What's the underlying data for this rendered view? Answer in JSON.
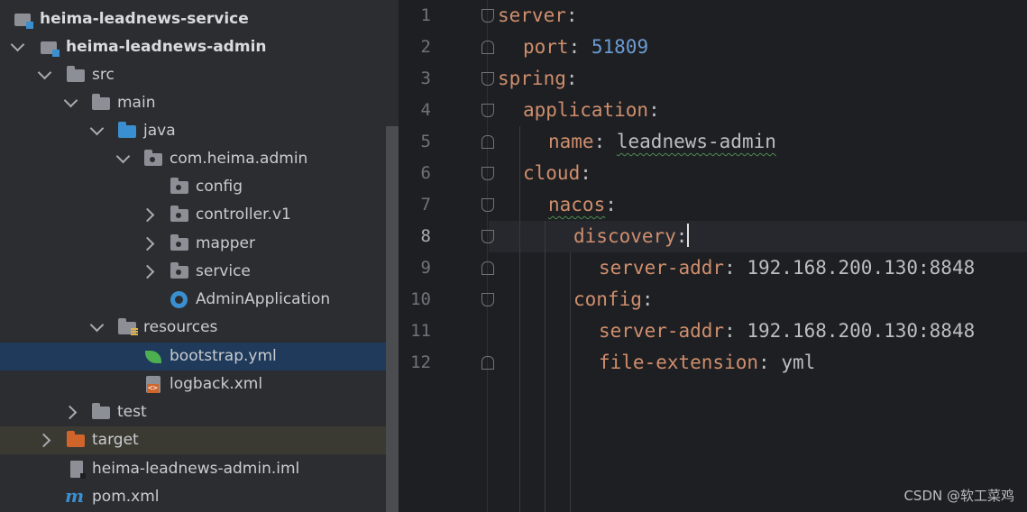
{
  "project_tree": {
    "items": [
      {
        "label": "heima-leadnews-service",
        "icon": "module-icon"
      },
      {
        "label": "heima-leadnews-admin",
        "icon": "module-icon"
      },
      {
        "label": "src",
        "icon": "folder-icon"
      },
      {
        "label": "main",
        "icon": "folder-icon"
      },
      {
        "label": "java",
        "icon": "source-folder-icon"
      },
      {
        "label": "com.heima.admin",
        "icon": "package-icon"
      },
      {
        "label": "config",
        "icon": "package-icon"
      },
      {
        "label": "controller.v1",
        "icon": "package-icon"
      },
      {
        "label": "mapper",
        "icon": "package-icon"
      },
      {
        "label": "service",
        "icon": "package-icon"
      },
      {
        "label": "AdminApplication",
        "icon": "spring-boot-app-icon"
      },
      {
        "label": "resources",
        "icon": "resources-folder-icon"
      },
      {
        "label": "bootstrap.yml",
        "icon": "spring-yaml-icon",
        "selected": true
      },
      {
        "label": "logback.xml",
        "icon": "xml-file-icon"
      },
      {
        "label": "test",
        "icon": "folder-icon"
      },
      {
        "label": "target",
        "icon": "excluded-folder-icon"
      },
      {
        "label": "heima-leadnews-admin.iml",
        "icon": "iml-file-icon"
      },
      {
        "label": "pom.xml",
        "icon": "maven-icon"
      }
    ]
  },
  "editor": {
    "line_numbers": [
      "1",
      "2",
      "3",
      "4",
      "5",
      "6",
      "7",
      "8",
      "9",
      "10",
      "11",
      "12"
    ],
    "current_line": "8",
    "lines": [
      {
        "key": "server",
        "sep": ":",
        "value": ""
      },
      {
        "key": "port",
        "sep": ": ",
        "value": "51809"
      },
      {
        "key": "spring",
        "sep": ":",
        "value": ""
      },
      {
        "key": "application",
        "sep": ":",
        "value": ""
      },
      {
        "key": "name",
        "sep": ": ",
        "value": "leadnews-admin"
      },
      {
        "key": "cloud",
        "sep": ":",
        "value": ""
      },
      {
        "key": "nacos",
        "sep": ":",
        "value": ""
      },
      {
        "key": "discovery",
        "sep": ":",
        "value": ""
      },
      {
        "key": "server-addr",
        "sep": ": ",
        "value": "192.168.200.130:8848"
      },
      {
        "key": "config",
        "sep": ":",
        "value": ""
      },
      {
        "key": "server-addr",
        "sep": ": ",
        "value": "192.168.200.130:8848"
      },
      {
        "key": "file-extension",
        "sep": ": ",
        "value": "yml"
      }
    ]
  },
  "watermark": "CSDN @软工菜鸡",
  "colors": {
    "key": "#cf8e6d",
    "number": "#6b9bd2",
    "text": "#bcbec4",
    "selection": "#1f3a5b"
  }
}
